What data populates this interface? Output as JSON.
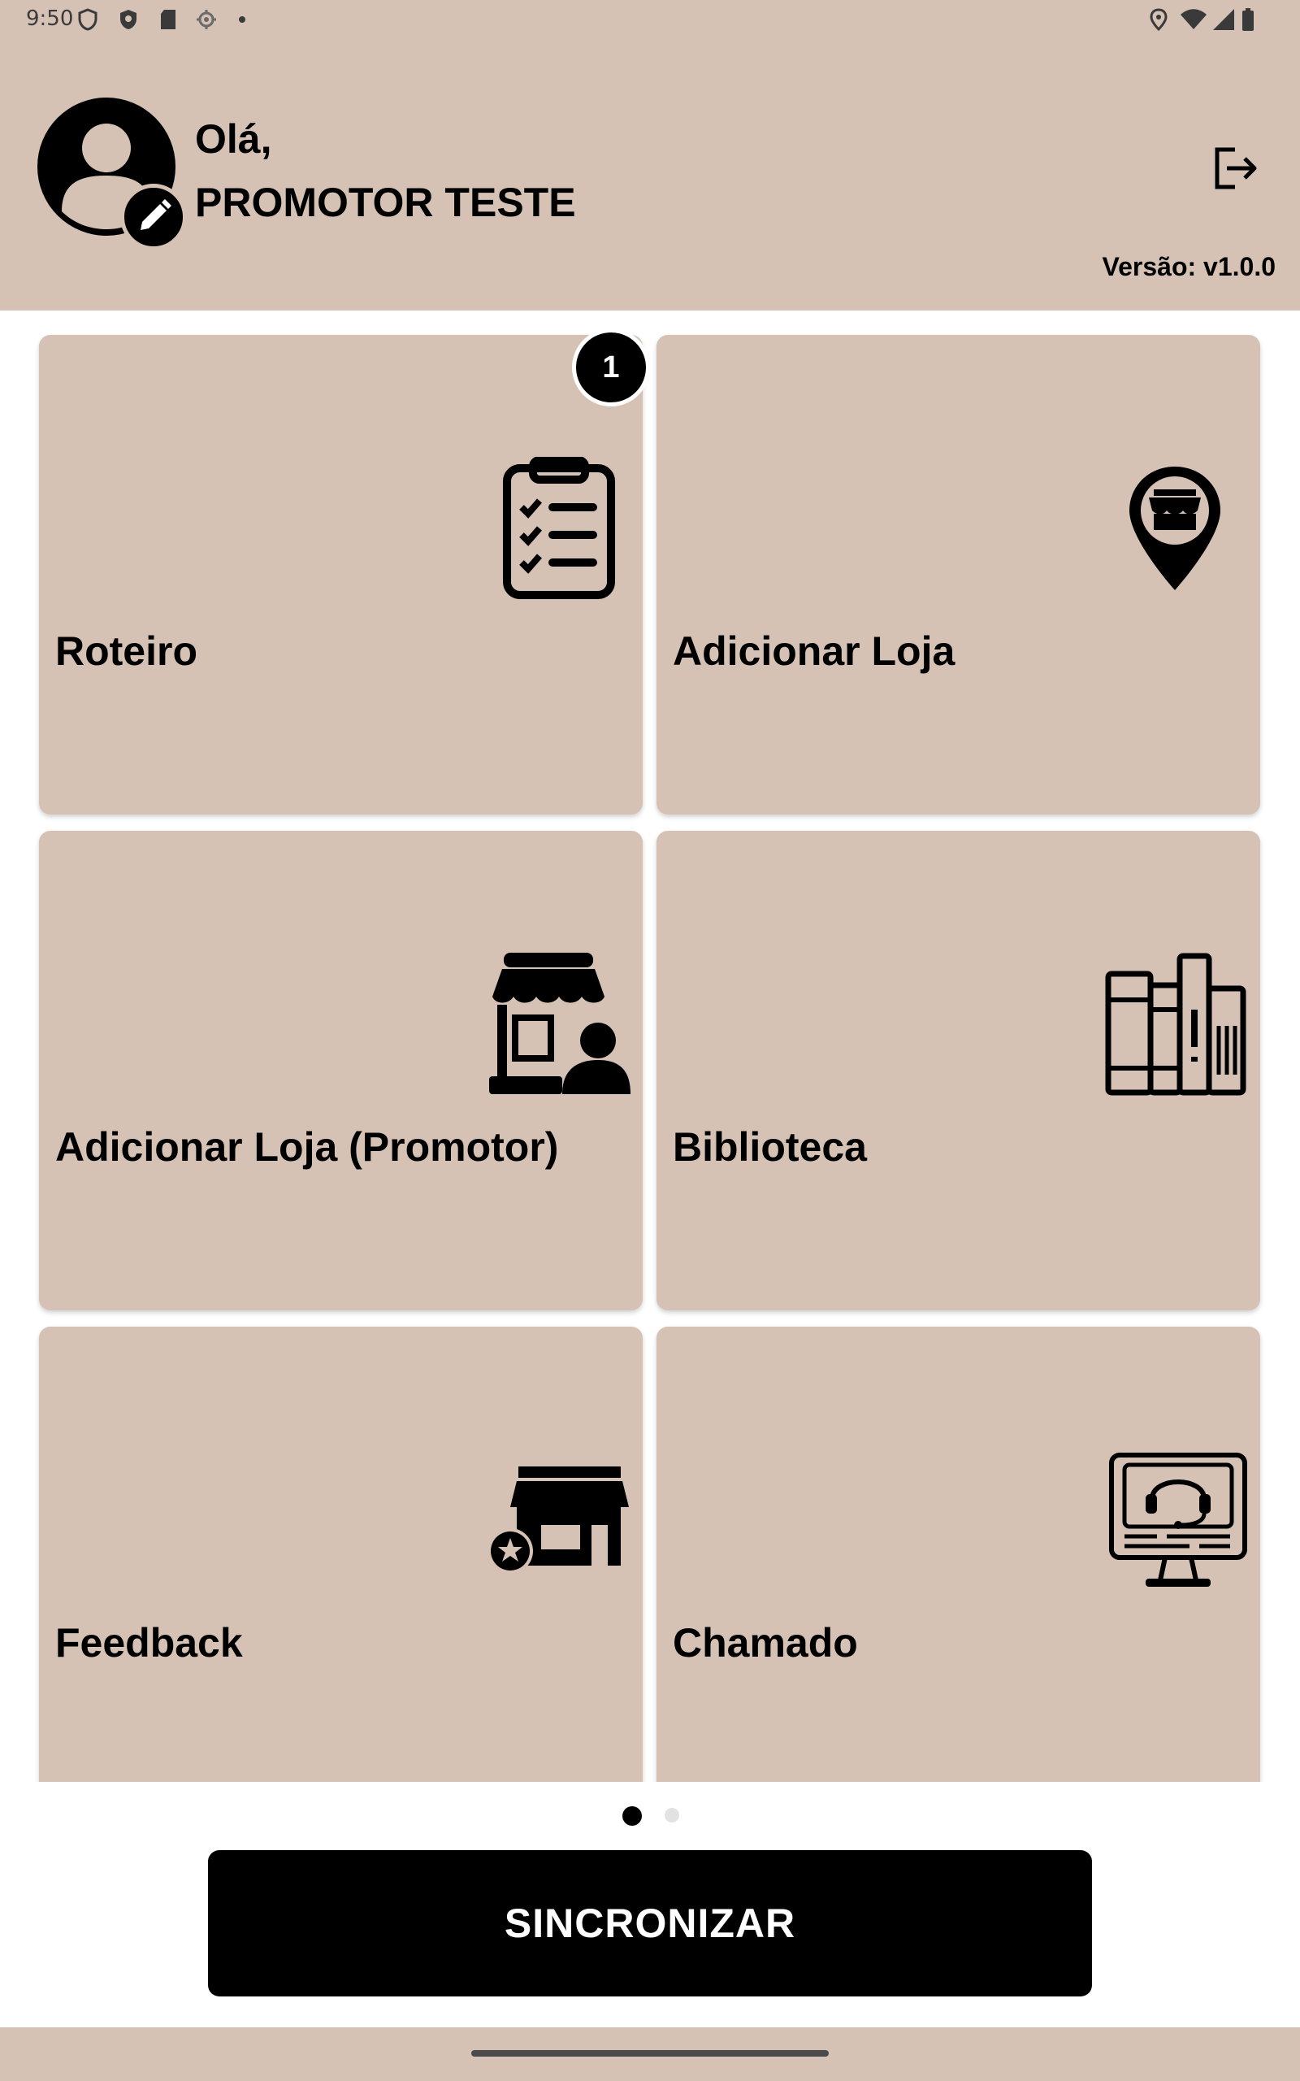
{
  "status_bar": {
    "time": "9:50",
    "icons": [
      "shield-outline-icon",
      "shield-icon",
      "sd-card-icon",
      "gps-icon",
      "dot-icon",
      "location-icon",
      "wifi-icon",
      "signal-icon",
      "battery-icon"
    ]
  },
  "header": {
    "greeting": "Olá,",
    "user_name": "PROMOTOR TESTE",
    "version": "Versão: v1.0.0",
    "icons": [
      "avatar-icon",
      "edit-icon",
      "logout-icon"
    ]
  },
  "tiles": [
    {
      "label": "Roteiro",
      "icon": "clipboard-checklist-icon",
      "badge": "1"
    },
    {
      "label": "Adicionar Loja",
      "icon": "store-pin-icon"
    },
    {
      "label": "Adicionar Loja (Promotor)",
      "icon": "store-person-icon"
    },
    {
      "label": "Biblioteca",
      "icon": "books-icon"
    },
    {
      "label": "Feedback",
      "icon": "store-star-icon"
    },
    {
      "label": "Chamado",
      "icon": "support-monitor-icon"
    }
  ],
  "pager": {
    "pages": 2,
    "current": 1
  },
  "sync_button": {
    "label": "SINCRONIZAR"
  },
  "colors": {
    "header_bg": "#d5c2b5",
    "tile_bg": "#d5c2b5",
    "button_bg": "#000000",
    "button_text": "#ffffff"
  }
}
